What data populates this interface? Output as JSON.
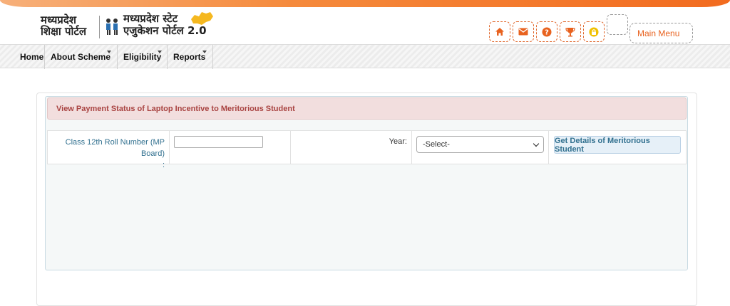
{
  "header": {
    "logo_left_line1": "मध्यप्रदेश",
    "logo_left_line2": "शिक्षा पोर्टल",
    "logo_right_line1": "मध्यप्रदेश स्टेट",
    "logo_right_line2": "एजुकेशन पोर्टल 2.0",
    "icons": [
      "home-icon",
      "mail-icon",
      "help-icon",
      "trophy-icon",
      "lock-icon"
    ],
    "main_menu_label": "Main Menu",
    "accent_color": "#e8621f"
  },
  "nav": {
    "home": "Home",
    "about": "About Scheme",
    "eligibility": "Eligibility",
    "reports": "Reports"
  },
  "panel": {
    "title": "View Payment Status of Laptop Incentive to Meritorious Student",
    "roll_label": "Class 12th Roll Number (MP Board)",
    "roll_colon": ":",
    "roll_value": "",
    "year_label": "Year:",
    "year_selected": "-Select-",
    "button_label": "Get Details of Meritorious Student"
  }
}
